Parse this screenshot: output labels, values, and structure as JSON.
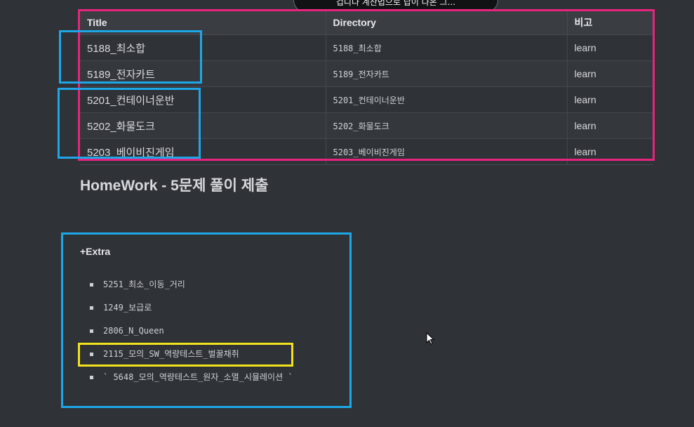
{
  "tooltip": {
    "text": "겁니다 계산법으로 답이 나온 그..."
  },
  "table": {
    "headers": [
      "Title",
      "Directory",
      "비고"
    ],
    "rows": [
      {
        "title": "5188_최소합",
        "directory": "5188_최소합",
        "note": "learn"
      },
      {
        "title": "5189_전자카트",
        "directory": "5189_전자카트",
        "note": "learn"
      },
      {
        "title": "5201_컨테이너운반",
        "directory": "5201_컨테이너운반",
        "note": "learn"
      },
      {
        "title": "5202_화물도크",
        "directory": "5202_화물도크",
        "note": "learn"
      },
      {
        "title": "5203_베이비진게임",
        "directory": "5203_베이비진게임",
        "note": "learn"
      }
    ]
  },
  "homework": {
    "title": "HomeWork - 5문제 풀이 제출"
  },
  "extra": {
    "title": "+Extra",
    "items": [
      "5251_최소_이동_거리",
      "1249_보급로",
      "2806_N_Queen",
      "2115_모의_SW_역량테스트_벌꿀채취",
      "` 5648_모의_역량테스트_원자_소멸_시뮬레이션 `"
    ]
  },
  "colors": {
    "background": "#2f3237",
    "pink_box": "#e8247f",
    "cyan_box": "#1ea7e8",
    "yellow_box": "#f2e21c"
  }
}
